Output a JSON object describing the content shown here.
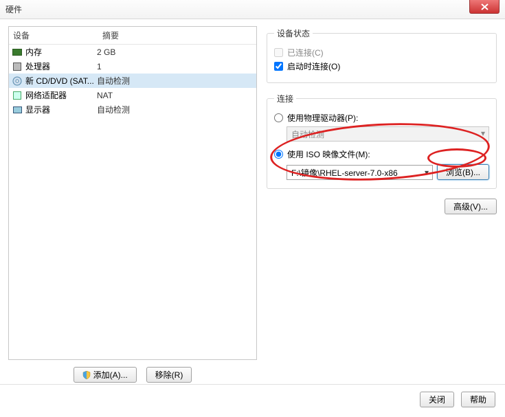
{
  "window": {
    "title": "硬件"
  },
  "left": {
    "headers": {
      "device": "设备",
      "summary": "摘要"
    },
    "rows": [
      {
        "name": "内存",
        "summary": "2 GB",
        "icon": "memory"
      },
      {
        "name": "处理器",
        "summary": "1",
        "icon": "cpu"
      },
      {
        "name": "新 CD/DVD (SAT...",
        "summary": "自动检测",
        "icon": "disc",
        "selected": true
      },
      {
        "name": "网络适配器",
        "summary": "NAT",
        "icon": "net"
      },
      {
        "name": "显示器",
        "summary": "自动检测",
        "icon": "monitor"
      }
    ],
    "add": "添加(A)...",
    "remove": "移除(R)"
  },
  "status": {
    "legend": "设备状态",
    "connected": "已连接(C)",
    "connect_on_power": "启动时连接(O)"
  },
  "connection": {
    "legend": "连接",
    "use_physical": "使用物理驱动器(P):",
    "physical_value": "自动检测",
    "use_iso": "使用 ISO 映像文件(M):",
    "iso_path": "F:\\镜像\\RHEL-server-7.0-x86",
    "browse": "浏览(B)..."
  },
  "advanced": "高级(V)...",
  "footer": {
    "close": "关闭",
    "help": "帮助"
  }
}
